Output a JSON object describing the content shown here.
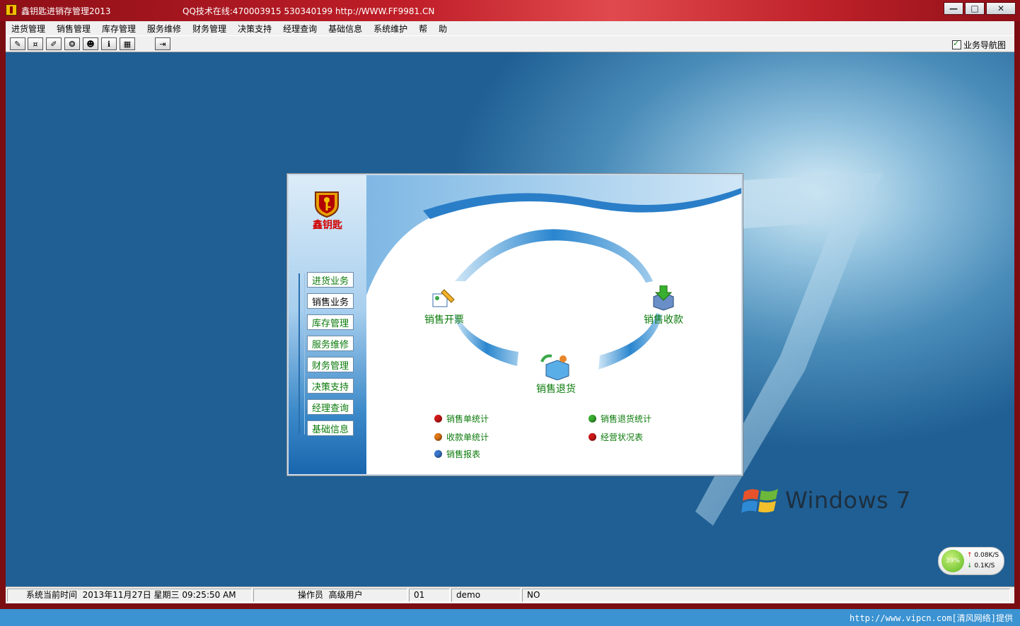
{
  "window": {
    "title": "鑫钥匙进销存管理2013",
    "support": "QQ技术在线:470003915  530340199  http://WWW.FF9981.CN"
  },
  "menu": [
    "进货管理",
    "销售管理",
    "库存管理",
    "服务维修",
    "财务管理",
    "决策支持",
    "经理查询",
    "基础信息",
    "系统维护",
    "帮",
    "助"
  ],
  "toolbar": {
    "nav_toggle_label": "业务导航图",
    "nav_toggle_checked": true
  },
  "dialog": {
    "brand": "鑫钥匙",
    "nav": [
      "进货业务",
      "销售业务",
      "库存管理",
      "服务维修",
      "财务管理",
      "决策支持",
      "经理查询",
      "基础信息"
    ],
    "active_nav": "销售业务",
    "flow": {
      "invoice": "销售开票",
      "receipt": "销售收款",
      "return": "销售退货"
    },
    "reports": [
      {
        "label": "销售单统计",
        "color": "#d01818"
      },
      {
        "label": "收款单统计",
        "color": "#e07818"
      },
      {
        "label": "销售报表",
        "color": "#3a78d0"
      },
      {
        "label": "销售退货统计",
        "color": "#38b030"
      },
      {
        "label": "经营状况表",
        "color": "#d01818"
      }
    ]
  },
  "desktop": {
    "os_brand": "Windows",
    "os_version": "7"
  },
  "network": {
    "percent": "39%",
    "upload": "0.08K/S",
    "download": "0.1K/S"
  },
  "status": {
    "time_label": "系统当前时间",
    "time_value": "2013年11月27日 星期三 09:25:50 AM",
    "operator_label": "操作员",
    "operator_role": "高级用户",
    "code": "01",
    "user": "demo",
    "flag": "NO"
  },
  "credit": "http://www.vipcn.com[清风网络]提供"
}
